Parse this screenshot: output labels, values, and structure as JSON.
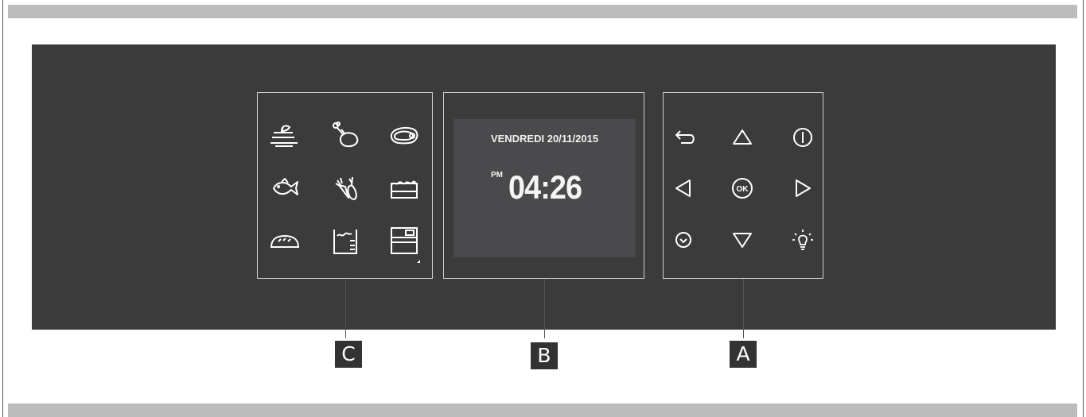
{
  "display": {
    "date": "VENDREDI 20/11/2015",
    "ampm": "PM",
    "time": "04:26"
  },
  "callouts": {
    "c": "C",
    "b": "B",
    "a": "A"
  },
  "function_icons": [
    "plated-meal-icon",
    "poultry-icon",
    "meat-steak-icon",
    "fish-icon",
    "vegetables-icon",
    "cake-icon",
    "bread-icon",
    "dough-proving-icon",
    "oven-icon"
  ],
  "control_icons": [
    "back-arrow-icon",
    "up-arrow-icon",
    "power-icon",
    "left-arrow-icon",
    "ok-icon",
    "right-arrow-icon",
    "clock-icon",
    "down-arrow-icon",
    "light-bulb-icon"
  ],
  "ok_label": "OK",
  "colors": {
    "panel_background": "#3b3b3b",
    "screen_background": "#4a4a4c",
    "bars": "#bcbcbc",
    "callout_background": "#333333"
  }
}
